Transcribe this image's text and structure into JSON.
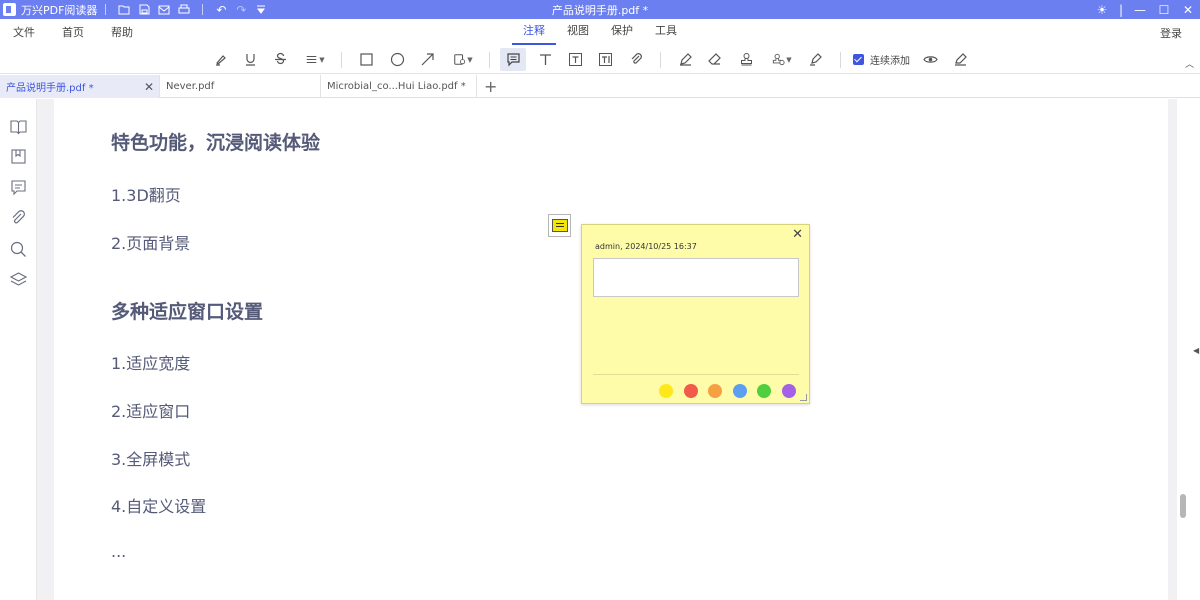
{
  "app": {
    "name": "万兴PDF阅读器",
    "window_title": "产品说明手册.pdf *"
  },
  "menu": {
    "items": [
      "文件",
      "首页",
      "帮助"
    ],
    "center_tabs": [
      "注释",
      "视图",
      "保护",
      "工具"
    ],
    "active_tab": "注释",
    "login": "登录"
  },
  "toolbar": {
    "continuous_add_label": "连续添加",
    "continuous_add_checked": true
  },
  "tabs": [
    {
      "label": "产品说明手册.pdf *",
      "active": true
    },
    {
      "label": "Never.pdf",
      "active": false
    },
    {
      "label": "Microbial_co...Hui Liao.pdf *",
      "active": false
    }
  ],
  "document": {
    "heading1": "特色功能，沉浸阅读体验",
    "item1": "1.3D翻页",
    "item2": "2.页面背景",
    "heading2": "多种适应窗口设置",
    "item3": "1.适应宽度",
    "item4": "2.适应窗口",
    "item5": "3.全屏模式",
    "item6": "4.自定义设置",
    "ellipsis": "..."
  },
  "note": {
    "meta": "admin,  2024/10/25 16:37",
    "text": "",
    "colors": [
      "#ffe81a",
      "#f25a4a",
      "#f5a142",
      "#5c9ff0",
      "#4fce3e",
      "#a461e5"
    ]
  },
  "colors": {
    "accent": "#3d55e0",
    "titlebar": "#6c7ff0",
    "note_bg": "#fefca9"
  }
}
